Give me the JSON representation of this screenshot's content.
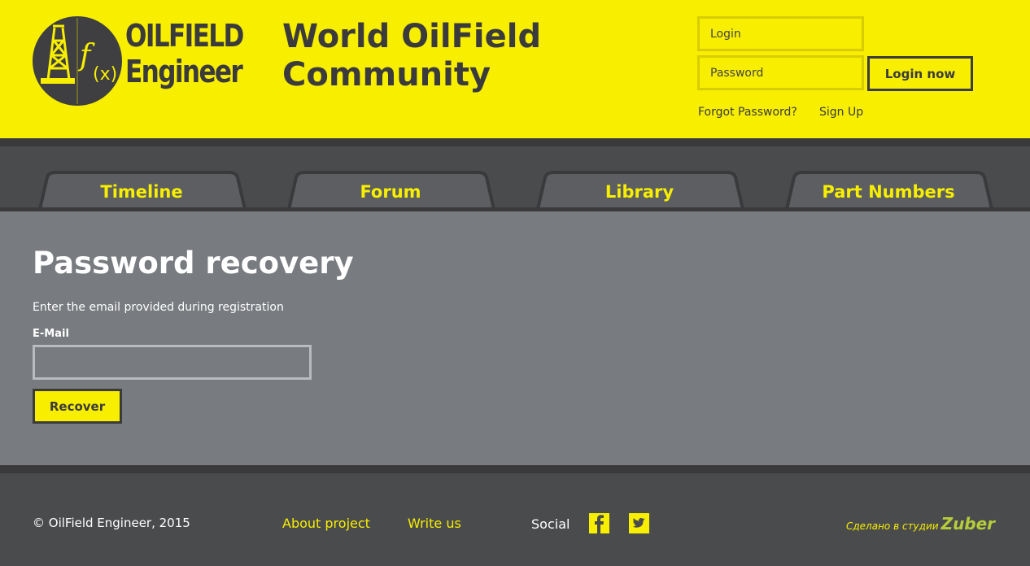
{
  "header": {
    "logo_line1": "OILFIELD",
    "logo_line2": "Engineer",
    "logo_formula": "f(x)",
    "site_title_line1": "World OilField",
    "site_title_line2": "Community",
    "login_placeholder": "Login",
    "password_placeholder": "Password",
    "login_button": "Login now",
    "forgot_password": "Forgot Password?",
    "sign_up": "Sign Up"
  },
  "nav": {
    "tabs": [
      {
        "label": "Timeline"
      },
      {
        "label": "Forum"
      },
      {
        "label": "Library"
      },
      {
        "label": "Part Numbers"
      }
    ]
  },
  "main": {
    "title": "Password recovery",
    "intro": "Enter the email provided during registration",
    "email_label": "E-Mail",
    "email_value": "",
    "recover_button": "Recover"
  },
  "footer": {
    "copyright": "© OilField Engineer, 2015",
    "about_link": "About project",
    "write_link": "Write us",
    "social_label": "Social",
    "studio_text": "Сделано в студии",
    "studio_logo": "Zuber"
  },
  "colors": {
    "brand_yellow": "#f7ee00",
    "dark_gray": "#3b3b3d",
    "content_gray": "#787b7f",
    "nav_gray": "#4a4b4d"
  }
}
